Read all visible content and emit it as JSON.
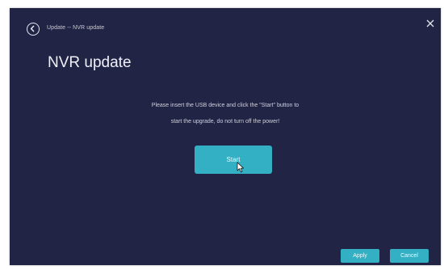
{
  "header": {
    "back_icon": "back-circle-icon",
    "breadcrumb": "Update -- NVR update",
    "close_icon": "close-icon"
  },
  "main": {
    "title": "NVR update",
    "message_line1": "Please insert the USB device and click the \"Start\" button to",
    "message_line2": "start the upgrade, do not turn off the power!",
    "start_label": "Start"
  },
  "footer": {
    "apply_label": "Apply",
    "cancel_label": "Cancel"
  },
  "colors": {
    "background": "#222445",
    "accent": "#34b0c4",
    "text": "#eef0f8"
  }
}
